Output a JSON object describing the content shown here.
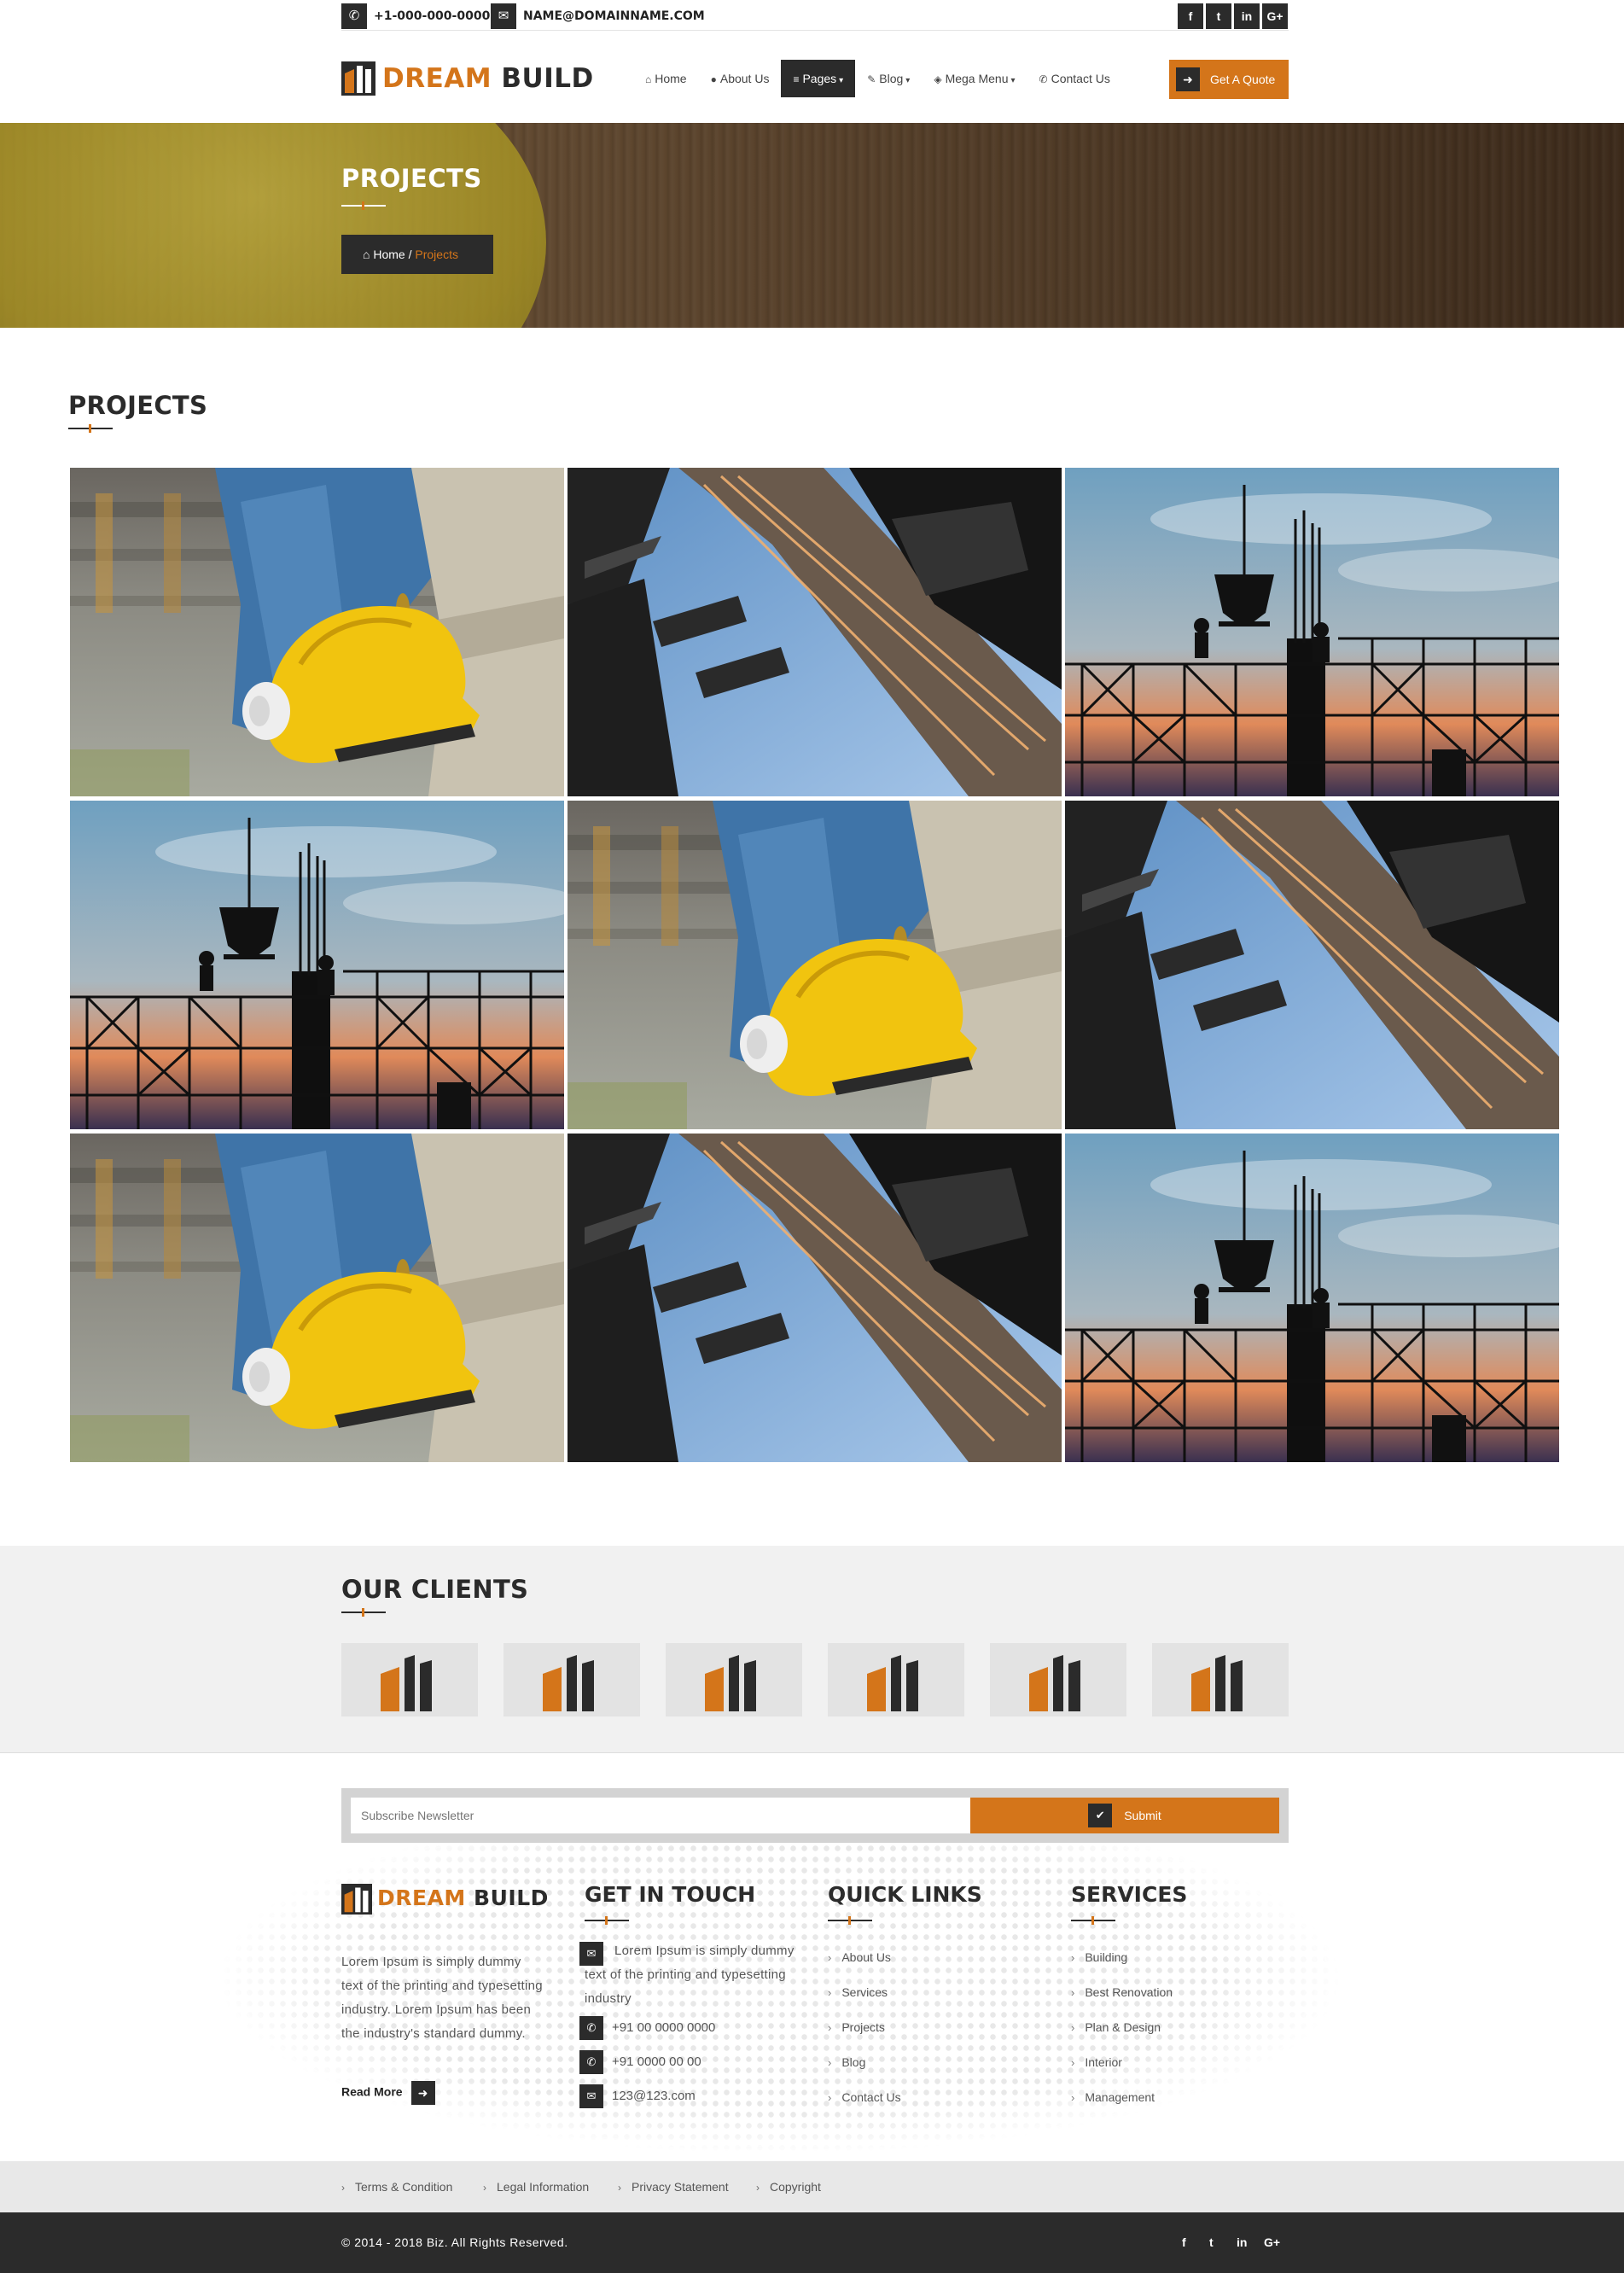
{
  "topbar": {
    "phone": "+1-000-000-0000",
    "email": "NAME@DOMAINNAME.COM",
    "social": [
      "f",
      "t",
      "in",
      "G+"
    ]
  },
  "brand": {
    "name_part1": "DREAM",
    "name_part2": "BUILD",
    "accent": "#d4751a",
    "dark": "#2b2b2b"
  },
  "nav": {
    "items": [
      {
        "label": "Home",
        "icon": "home-icon"
      },
      {
        "label": "About Us",
        "icon": "user-icon"
      },
      {
        "label": "Pages",
        "icon": "list-icon"
      },
      {
        "label": "Blog",
        "icon": "pencil-icon"
      },
      {
        "label": "Mega Menu",
        "icon": "cube-icon"
      },
      {
        "label": "Contact Us",
        "icon": "phone-icon"
      }
    ],
    "active": "Pages",
    "quote_label": "Get A Quote"
  },
  "banner": {
    "title": "PROJECTS",
    "breadcrumb_home": "Home",
    "breadcrumb_sep": "/",
    "breadcrumb_current": "Projects"
  },
  "projects": {
    "title": "PROJECTS",
    "tiles": [
      "helmet",
      "building",
      "crane",
      "crane",
      "helmet",
      "building",
      "helmet",
      "building",
      "crane"
    ]
  },
  "clients": {
    "title": "OUR CLIENTS",
    "count": 6
  },
  "newsletter": {
    "placeholder": "Subscribe Newsletter",
    "button": "Submit"
  },
  "footer": {
    "about_text": "Lorem Ipsum is simply dummy text of the printing and typesetting industry. Lorem Ipsum has been the industry's standard dummy.",
    "read_more": "Read More",
    "get_in_touch": {
      "title": "GET IN TOUCH",
      "address": "Lorem Ipsum is simply dummy text of the printing and typesetting industry",
      "phone1": "+91 00 0000 0000",
      "phone2": "+91 0000 00 00",
      "email": "123@123.com"
    },
    "quick_links": {
      "title": "QUICK LINKS",
      "items": [
        "About Us",
        "Services",
        "Projects",
        "Blog",
        "Contact Us"
      ]
    },
    "services": {
      "title": "SERVICES",
      "items": [
        "Building",
        "Best Renovation",
        "Plan & Design",
        "Interior",
        "Management"
      ]
    }
  },
  "legal": [
    "Terms & Condition",
    "Legal Information",
    "Privacy Statement",
    "Copyright"
  ],
  "copyright": "© 2014 - 2018 Biz. All Rights Reserved.",
  "bottom_social": [
    "f",
    "t",
    "in",
    "G+"
  ]
}
